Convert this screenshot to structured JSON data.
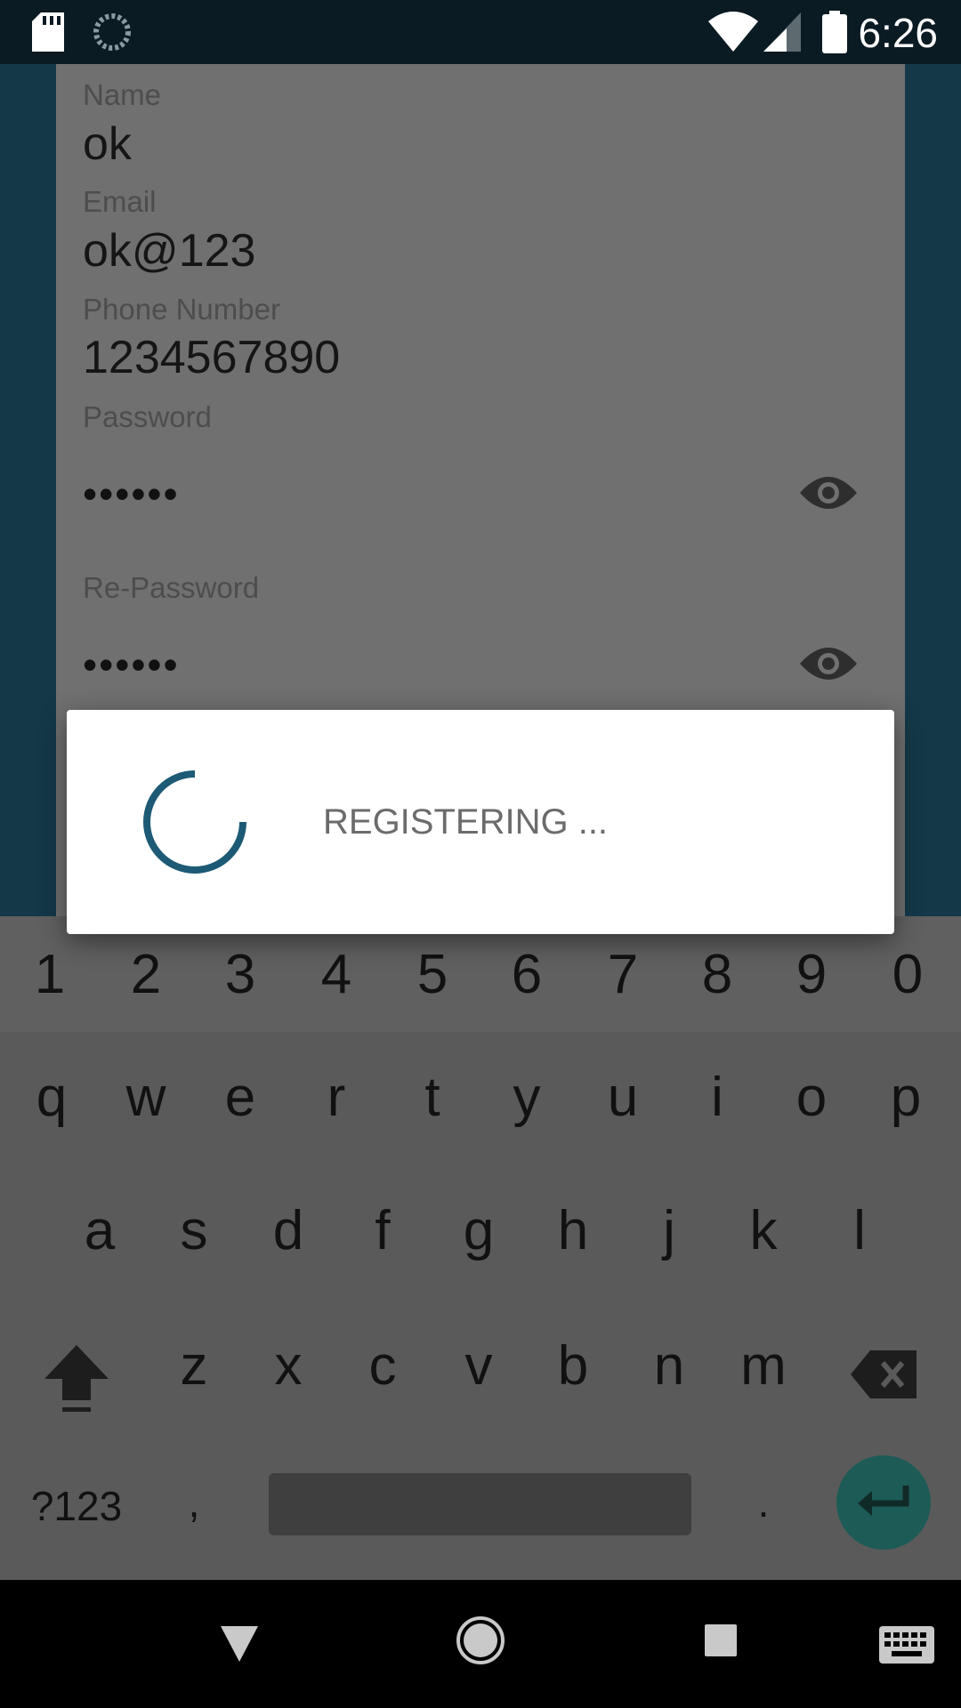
{
  "status_bar": {
    "time": "6:26",
    "icons": [
      "sd-card-icon",
      "sync-icon",
      "wifi-icon",
      "signal-icon",
      "battery-icon"
    ]
  },
  "form": {
    "name_label": "Name",
    "name_value": "ok",
    "email_label": "Email",
    "email_value": "ok@123",
    "phone_label": "Phone Number",
    "phone_value": "1234567890",
    "password_label": "Password",
    "password_value": "••••••",
    "repassword_label": "Re-Password",
    "repassword_value": "••••••"
  },
  "dialog": {
    "message": "REGISTERING ..."
  },
  "keyboard": {
    "numbers": [
      "1",
      "2",
      "3",
      "4",
      "5",
      "6",
      "7",
      "8",
      "9",
      "0"
    ],
    "row1": [
      "q",
      "w",
      "e",
      "r",
      "t",
      "y",
      "u",
      "i",
      "o",
      "p"
    ],
    "row2": [
      "a",
      "s",
      "d",
      "f",
      "g",
      "h",
      "j",
      "k",
      "l"
    ],
    "row3": [
      "z",
      "x",
      "c",
      "v",
      "b",
      "n",
      "m"
    ],
    "symbols_key": "?123",
    "comma_key": ",",
    "period_key": "."
  },
  "colors": {
    "accent": "#1d5a75",
    "enter": "#1d5b56"
  }
}
